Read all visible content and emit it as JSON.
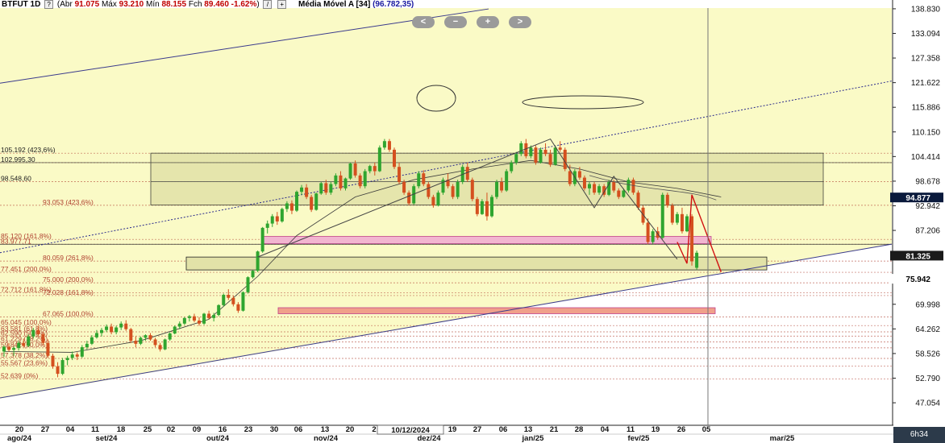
{
  "header": {
    "symbol": "BTFUT 1D",
    "box1": "?",
    "open_label": "Abr",
    "open": "91.075",
    "high_label": "Máx",
    "high": "93.210",
    "low_label": "Mín",
    "low": "88.155",
    "close_label": "Fch",
    "close": "89.460",
    "change": "-1.62%",
    "box2": "/",
    "box3": "+",
    "ma_label": "Média Móvel A [34]",
    "ma_value": "(96.782,35)"
  },
  "nav": {
    "prev": "<",
    "zoom_out": "−",
    "zoom_in": "+",
    "next": ">"
  },
  "crosshair_date": "10/12/2024",
  "time_box": "6h34",
  "colors": {
    "background": "#fafac6",
    "up": "#2fa52f",
    "down": "#d4501f",
    "price_box_blue": "#0a1a3c",
    "price_box_dark": "#1a1a1a",
    "fib_line": "#b04030"
  },
  "chart_data": {
    "type": "candlestick",
    "ylim": [
      42,
      139
    ],
    "y_ticks": [
      "138.830",
      "133.094",
      "127.358",
      "121.622",
      "115.886",
      "110.150",
      "104.414",
      "98.678",
      "92.942",
      "87.206",
      "75.942",
      "69.998",
      "64.262",
      "58.526",
      "52.790",
      "47.054"
    ],
    "price_labels": [
      {
        "text": "94.877",
        "value": 94.877,
        "style": "blue"
      },
      {
        "text": "81.325",
        "value": 81.325,
        "style": "dark"
      },
      {
        "text": "75.942",
        "value": 75.942,
        "style": "plain"
      }
    ],
    "x_ticks": [
      "20",
      "27",
      "04",
      "11",
      "18",
      "25",
      "02",
      "09",
      "16",
      "23",
      "30",
      "06",
      "13",
      "20",
      "2",
      "19",
      "27",
      "06",
      "13",
      "21",
      "28",
      "04",
      "11",
      "19",
      "26",
      "05"
    ],
    "months": [
      "ago/24",
      "set/24",
      "out/24",
      "nov/24",
      "dez/24",
      "jan/25",
      "fev/25",
      "mar/25"
    ],
    "fib_levels": [
      {
        "text": "105.192 (423,6%)",
        "value": 105.192
      },
      {
        "text": "102.995,30",
        "value": 102.995
      },
      {
        "text": "98.548,60",
        "value": 98.549
      },
      {
        "text": "93.053 (423,6%)",
        "value": 93.053
      },
      {
        "text": "85.120 (161,8%)",
        "value": 85.12
      },
      {
        "text": "83.977,71",
        "value": 83.978
      },
      {
        "text": "80.059 (261,8%)",
        "value": 80.059
      },
      {
        "text": "77.451 (200,0%)",
        "value": 77.451
      },
      {
        "text": "75.000 (200,0%)",
        "value": 75.0
      },
      {
        "text": "72.712 (161,8%)",
        "value": 72.712
      },
      {
        "text": "72.028 (161,8%)",
        "value": 72.028
      },
      {
        "text": "67.065 (100,0%)",
        "value": 67.065
      },
      {
        "text": "65.045 (100,0%)",
        "value": 65.045
      },
      {
        "text": "63.581 (61,8%)",
        "value": 63.581
      },
      {
        "text": "62.590 (50,0%)",
        "value": 62.59
      },
      {
        "text": "61.229 (38,2%)",
        "value": 61.229
      },
      {
        "text": "59.842 (50,0%)",
        "value": 59.842
      },
      {
        "text": "57.378 (38,2%)",
        "value": 57.378
      },
      {
        "text": "55.567 (23,6%)",
        "value": 55.567
      },
      {
        "text": "52.639 (0%)",
        "value": 52.639
      }
    ],
    "candles": [
      [
        59.0,
        60.4,
        57.8,
        60.1
      ],
      [
        60.1,
        61.0,
        59.0,
        59.4
      ],
      [
        59.4,
        60.2,
        58.0,
        59.8
      ],
      [
        59.8,
        61.5,
        59.2,
        61.0
      ],
      [
        61.0,
        62.0,
        60.0,
        60.3
      ],
      [
        60.3,
        63.0,
        60.0,
        62.5
      ],
      [
        62.5,
        64.5,
        62.0,
        64.0
      ],
      [
        64.0,
        65.0,
        62.5,
        63.0
      ],
      [
        63.0,
        63.5,
        60.5,
        61.0
      ],
      [
        61.0,
        61.8,
        57.5,
        58.0
      ],
      [
        58.0,
        58.5,
        55.0,
        55.5
      ],
      [
        55.5,
        56.5,
        53.0,
        53.8
      ],
      [
        53.8,
        57.5,
        53.5,
        57.0
      ],
      [
        57.0,
        58.0,
        55.8,
        57.5
      ],
      [
        57.5,
        59.0,
        57.0,
        58.3
      ],
      [
        58.3,
        58.8,
        57.0,
        57.8
      ],
      [
        57.8,
        60.5,
        57.5,
        60.0
      ],
      [
        60.0,
        61.5,
        59.5,
        60.8
      ],
      [
        60.8,
        62.8,
        60.5,
        62.3
      ],
      [
        62.3,
        64.0,
        62.0,
        63.3
      ],
      [
        63.3,
        64.5,
        62.5,
        64.0
      ],
      [
        64.0,
        65.3,
        63.5,
        64.8
      ],
      [
        64.8,
        65.5,
        63.0,
        63.5
      ],
      [
        63.5,
        65.0,
        63.0,
        64.6
      ],
      [
        64.6,
        66.0,
        64.0,
        65.5
      ],
      [
        65.5,
        66.3,
        63.8,
        64.2
      ],
      [
        64.2,
        64.5,
        61.0,
        61.5
      ],
      [
        61.5,
        62.5,
        60.0,
        60.8
      ],
      [
        60.8,
        62.5,
        60.5,
        62.2
      ],
      [
        62.2,
        63.0,
        61.5,
        62.8
      ],
      [
        62.8,
        63.3,
        61.5,
        61.8
      ],
      [
        61.8,
        62.2,
        60.0,
        60.5
      ],
      [
        60.5,
        61.0,
        59.0,
        59.5
      ],
      [
        59.5,
        62.0,
        59.3,
        61.8
      ],
      [
        61.8,
        63.5,
        61.5,
        63.2
      ],
      [
        63.2,
        65.0,
        63.0,
        64.8
      ],
      [
        64.8,
        66.0,
        64.2,
        65.5
      ],
      [
        65.5,
        67.0,
        65.2,
        66.8
      ],
      [
        66.8,
        67.5,
        66.0,
        67.2
      ],
      [
        67.2,
        67.8,
        65.8,
        66.2
      ],
      [
        66.2,
        67.0,
        65.0,
        65.5
      ],
      [
        65.5,
        68.0,
        65.2,
        67.8
      ],
      [
        67.8,
        68.5,
        66.5,
        66.8
      ],
      [
        66.8,
        68.0,
        66.0,
        67.5
      ],
      [
        67.5,
        70.0,
        67.2,
        69.8
      ],
      [
        69.8,
        72.5,
        69.5,
        72.2
      ],
      [
        72.2,
        73.5,
        71.0,
        71.5
      ],
      [
        71.5,
        72.0,
        69.5,
        70.0
      ],
      [
        70.0,
        70.5,
        68.0,
        68.5
      ],
      [
        68.5,
        73.0,
        68.3,
        72.8
      ],
      [
        72.8,
        76.5,
        72.5,
        76.3
      ],
      [
        76.3,
        78.0,
        76.0,
        77.8
      ],
      [
        77.8,
        82.5,
        77.5,
        82.3
      ],
      [
        82.3,
        88.0,
        82.0,
        87.8
      ],
      [
        87.8,
        89.5,
        86.5,
        88.8
      ],
      [
        88.8,
        91.0,
        88.0,
        90.5
      ],
      [
        90.5,
        91.5,
        88.5,
        89.3
      ],
      [
        89.3,
        92.5,
        89.0,
        92.2
      ],
      [
        92.2,
        94.0,
        91.5,
        93.5
      ],
      [
        93.5,
        94.2,
        91.0,
        91.8
      ],
      [
        91.8,
        96.5,
        91.5,
        96.2
      ],
      [
        96.2,
        97.8,
        95.5,
        97.2
      ],
      [
        97.2,
        98.0,
        94.5,
        95.0
      ],
      [
        95.0,
        95.5,
        91.5,
        92.0
      ],
      [
        92.0,
        96.0,
        91.8,
        95.8
      ],
      [
        95.8,
        98.5,
        95.5,
        98.2
      ],
      [
        98.2,
        99.0,
        95.5,
        96.0
      ],
      [
        96.0,
        98.5,
        95.5,
        98.0
      ],
      [
        98.0,
        100.5,
        97.5,
        100.0
      ],
      [
        100.0,
        101.0,
        96.5,
        97.0
      ],
      [
        97.0,
        99.5,
        96.5,
        99.3
      ],
      [
        99.3,
        103.0,
        99.0,
        102.8
      ],
      [
        102.8,
        103.5,
        99.5,
        100.0
      ],
      [
        100.0,
        100.5,
        97.0,
        97.5
      ],
      [
        97.5,
        101.5,
        97.0,
        101.0
      ],
      [
        101.0,
        102.5,
        100.5,
        102.2
      ],
      [
        102.2,
        103.0,
        100.0,
        101.0
      ],
      [
        101.0,
        107.0,
        100.8,
        106.5
      ],
      [
        106.5,
        108.5,
        106.0,
        108.0
      ],
      [
        108.0,
        108.5,
        105.5,
        106.0
      ],
      [
        106.0,
        106.5,
        101.5,
        102.0
      ],
      [
        102.0,
        103.0,
        98.0,
        98.5
      ],
      [
        98.5,
        99.0,
        95.5,
        96.0
      ],
      [
        96.0,
        96.5,
        93.0,
        93.5
      ],
      [
        93.5,
        98.0,
        93.2,
        97.5
      ],
      [
        97.5,
        101.0,
        97.0,
        100.5
      ],
      [
        100.5,
        101.2,
        97.5,
        98.0
      ],
      [
        98.0,
        98.5,
        94.5,
        95.0
      ],
      [
        95.0,
        95.5,
        92.5,
        93.0
      ],
      [
        93.0,
        96.5,
        92.8,
        96.0
      ],
      [
        96.0,
        99.5,
        95.5,
        99.0
      ],
      [
        99.0,
        100.5,
        97.0,
        97.5
      ],
      [
        97.5,
        98.0,
        94.5,
        95.0
      ],
      [
        95.0,
        99.0,
        94.5,
        98.5
      ],
      [
        98.5,
        102.5,
        98.0,
        102.0
      ],
      [
        102.0,
        103.0,
        98.5,
        99.0
      ],
      [
        99.0,
        99.5,
        94.0,
        94.5
      ],
      [
        94.5,
        95.0,
        90.5,
        91.0
      ],
      [
        91.0,
        94.5,
        90.8,
        94.0
      ],
      [
        94.0,
        96.0,
        89.5,
        90.5
      ],
      [
        90.5,
        95.5,
        90.2,
        95.0
      ],
      [
        95.0,
        99.0,
        94.5,
        98.5
      ],
      [
        98.5,
        99.5,
        96.0,
        96.5
      ],
      [
        96.5,
        101.5,
        96.2,
        101.0
      ],
      [
        101.0,
        103.5,
        100.5,
        103.0
      ],
      [
        103.0,
        105.5,
        102.5,
        105.0
      ],
      [
        105.0,
        108.0,
        104.5,
        107.5
      ],
      [
        107.5,
        108.5,
        104.0,
        104.5
      ],
      [
        104.5,
        107.0,
        104.0,
        106.5
      ],
      [
        106.5,
        107.0,
        102.5,
        103.0
      ],
      [
        103.0,
        106.5,
        102.8,
        106.0
      ],
      [
        106.0,
        107.5,
        104.5,
        105.0
      ],
      [
        105.0,
        106.0,
        102.0,
        102.5
      ],
      [
        102.5,
        107.0,
        102.3,
        106.5
      ],
      [
        106.5,
        108.0,
        105.5,
        106.0
      ],
      [
        106.0,
        106.5,
        101.0,
        101.5
      ],
      [
        101.0,
        102.5,
        97.5,
        98.0
      ],
      [
        98.0,
        101.5,
        97.5,
        101.0
      ],
      [
        101.0,
        102.0,
        99.0,
        99.5
      ],
      [
        99.5,
        100.0,
        96.5,
        97.0
      ],
      [
        97.0,
        98.5,
        95.5,
        98.0
      ],
      [
        98.0,
        98.5,
        95.5,
        96.0
      ],
      [
        96.0,
        98.0,
        95.5,
        97.5
      ],
      [
        97.5,
        98.0,
        95.0,
        95.5
      ],
      [
        95.5,
        99.0,
        95.2,
        98.5
      ],
      [
        98.5,
        99.0,
        96.0,
        96.5
      ],
      [
        96.5,
        97.0,
        94.5,
        95.0
      ],
      [
        95.0,
        97.0,
        94.8,
        96.5
      ],
      [
        96.5,
        99.5,
        96.0,
        99.0
      ],
      [
        99.0,
        99.5,
        95.5,
        96.0
      ],
      [
        96.0,
        96.5,
        92.0,
        92.5
      ],
      [
        92.5,
        93.0,
        88.5,
        89.0
      ],
      [
        89.0,
        90.0,
        84.0,
        84.5
      ],
      [
        84.5,
        87.5,
        84.0,
        87.0
      ],
      [
        87.0,
        88.0,
        85.0,
        85.5
      ],
      [
        85.5,
        96.0,
        85.2,
        95.5
      ],
      [
        95.5,
        96.0,
        92.5,
        93.0
      ],
      [
        93.0,
        93.5,
        88.5,
        89.0
      ],
      [
        89.0,
        91.5,
        88.5,
        91.0
      ],
      [
        91.0,
        92.5,
        86.5,
        87.0
      ],
      [
        87.0,
        91.0,
        86.8,
        90.5
      ],
      [
        90.5,
        91.0,
        79.0,
        80.0
      ],
      [
        78.5,
        82.5,
        78.0,
        82.0
      ]
    ],
    "moving_average": [
      [
        0,
        59.0
      ],
      [
        14,
        58.8
      ],
      [
        28,
        61.5
      ],
      [
        42,
        66.5
      ],
      [
        52,
        76.5
      ],
      [
        60,
        86.0
      ],
      [
        72,
        95.0
      ],
      [
        84,
        99.0
      ],
      [
        96,
        101.5
      ],
      [
        108,
        103.5
      ],
      [
        118,
        101.5
      ],
      [
        128,
        98.5
      ],
      [
        138,
        97.0
      ],
      [
        147,
        95.0
      ]
    ]
  }
}
